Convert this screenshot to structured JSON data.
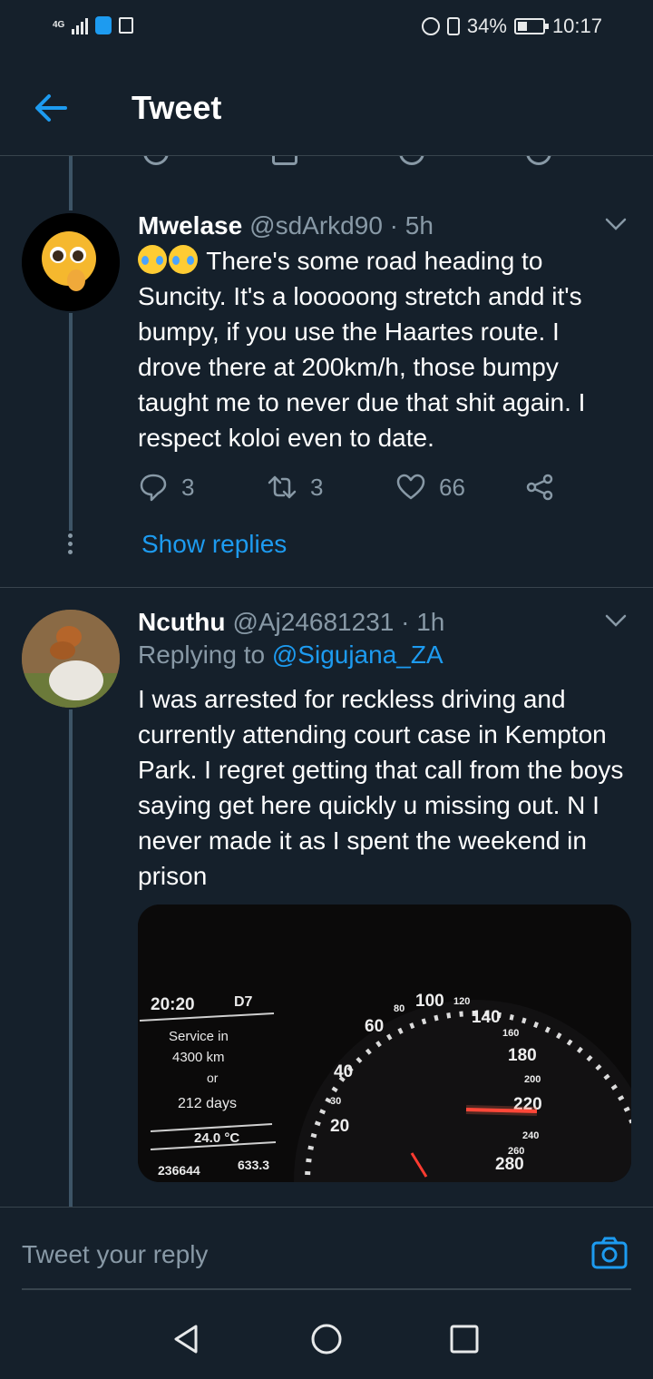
{
  "status_bar": {
    "network": "4G",
    "battery": "34%",
    "time": "10:17"
  },
  "header": {
    "title": "Tweet"
  },
  "tweets": [
    {
      "name": "Mwelase",
      "handle": "@sdArkd90 · 5h",
      "text": "There's some road heading to Suncity. It's a looooong stretch andd it's bumpy, if you use the Haartes route. I drove there at 200km/h, those bumpy taught me to never due that shit again. I respect koloi even to date.",
      "replies": "3",
      "retweets": "3",
      "likes": "66",
      "show_replies": "Show replies"
    },
    {
      "name": "Ncuthu",
      "handle": "@Aj24681231 · 1h",
      "replying_prefix": "Replying to ",
      "replying_to": "@Sigujana_ZA",
      "text": "I was arrested for reckless driving and currently attending court case in Kempton Park. I regret getting that call from the boys saying get here quickly u missing out. N I never made it as I spent the weekend in prison",
      "media": {
        "clock": "20:20",
        "gear": "D7",
        "service_line1": "Service in",
        "service_line2": "4300 km",
        "service_or": "or",
        "service_days": "212 days",
        "temp": "24.0 °C",
        "odometer": "236644",
        "trip": "633.3",
        "speed_ticks": [
          "20",
          "30",
          "40",
          "60",
          "80",
          "100",
          "120",
          "140",
          "160",
          "180",
          "200",
          "220",
          "240",
          "260",
          "280"
        ]
      }
    }
  ],
  "reply_bar": {
    "placeholder": "Tweet your reply"
  },
  "icons": {
    "back": "back-arrow-icon",
    "reply": "reply-icon",
    "retweet": "retweet-icon",
    "like": "heart-icon",
    "share": "share-icon",
    "caret": "chevron-down-icon",
    "camera": "camera-icon"
  },
  "colors": {
    "background": "#15202b",
    "accent": "#1d9bf0",
    "muted": "#8899a6",
    "divider": "#38444d"
  }
}
